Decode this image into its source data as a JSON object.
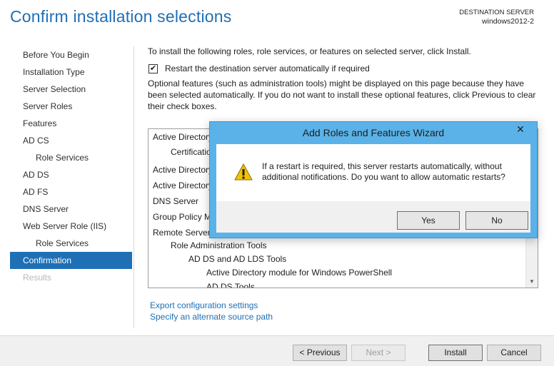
{
  "page": {
    "title": "Confirm installation selections",
    "destination_label": "DESTINATION SERVER",
    "destination_server": "windows2012-2"
  },
  "nav": {
    "items": [
      {
        "label": "Before You Begin",
        "state": "normal"
      },
      {
        "label": "Installation Type",
        "state": "normal"
      },
      {
        "label": "Server Selection",
        "state": "normal"
      },
      {
        "label": "Server Roles",
        "state": "normal"
      },
      {
        "label": "Features",
        "state": "normal"
      },
      {
        "label": "AD CS",
        "state": "normal"
      },
      {
        "label": "Role Services",
        "state": "sub"
      },
      {
        "label": "AD DS",
        "state": "normal"
      },
      {
        "label": "AD FS",
        "state": "normal"
      },
      {
        "label": "DNS Server",
        "state": "normal"
      },
      {
        "label": "Web Server Role (IIS)",
        "state": "normal"
      },
      {
        "label": "Role Services",
        "state": "sub"
      },
      {
        "label": "Confirmation",
        "state": "active"
      },
      {
        "label": "Results",
        "state": "disabled"
      }
    ]
  },
  "content": {
    "intro": "To install the following roles, role services, or features on selected server, click Install.",
    "restart_checkbox": {
      "label": "Restart the destination server automatically if required",
      "checked": true,
      "mark": "✔"
    },
    "optional_note": "Optional features (such as administration tools) might be displayed on this page because they have been selected automatically. If you do not want to install these optional features, click Previous to clear their check boxes.",
    "list": [
      "Active Directory",
      "Certification",
      "Active Directory",
      "Active Directory",
      "DNS Server",
      "Group Policy M",
      "Remote Server",
      "Role Administration Tools",
      "AD DS and AD LDS Tools",
      "Active Directory module for Windows PowerShell",
      "AD DS Tools"
    ],
    "links": {
      "export": "Export configuration settings",
      "alternate_source": "Specify an alternate source path"
    }
  },
  "footer": {
    "previous": "< Previous",
    "next": "Next >",
    "install": "Install",
    "cancel": "Cancel"
  },
  "dialog": {
    "title": "Add Roles and Features Wizard",
    "close": "✕",
    "icon": "warning-icon",
    "message": "If a restart is required, this server restarts automatically, without additional notifications. Do you want to allow automatic restarts?",
    "yes": "Yes",
    "no": "No",
    "title_bar_color": "#5ab2e8"
  },
  "colors": {
    "accent": "#1f6fb5",
    "warning": "#f2c400"
  },
  "scrollbar": {
    "up": "▲",
    "down": "▼"
  }
}
